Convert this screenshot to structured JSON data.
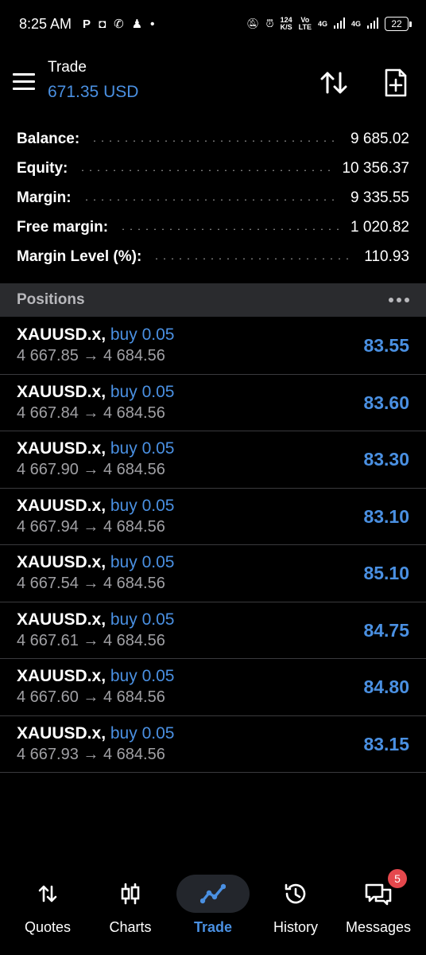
{
  "status_bar": {
    "time": "8:25 AM",
    "speed_value": "124",
    "speed_unit": "K/S",
    "volte_top": "Vo",
    "volte_bottom": "LTE",
    "net1": "4G",
    "net2": "4G",
    "battery": "22"
  },
  "header": {
    "title": "Trade",
    "subtitle": "671.35 USD"
  },
  "summary": [
    {
      "label": "Balance:",
      "value": "9 685.02"
    },
    {
      "label": "Equity:",
      "value": "10 356.37"
    },
    {
      "label": "Margin:",
      "value": "9 335.55"
    },
    {
      "label": "Free margin:",
      "value": "1 020.82"
    },
    {
      "label": "Margin Level (%):",
      "value": "110.93"
    }
  ],
  "positions_header": {
    "title": "Positions"
  },
  "positions": [
    {
      "symbol": "XAUUSD.x,",
      "side": "buy 0.05",
      "open": "4 667.85",
      "arrow": "→",
      "current": "4 684.56",
      "profit": "83.55"
    },
    {
      "symbol": "XAUUSD.x,",
      "side": "buy 0.05",
      "open": "4 667.84",
      "arrow": "→",
      "current": "4 684.56",
      "profit": "83.60"
    },
    {
      "symbol": "XAUUSD.x,",
      "side": "buy 0.05",
      "open": "4 667.90",
      "arrow": "→",
      "current": "4 684.56",
      "profit": "83.30"
    },
    {
      "symbol": "XAUUSD.x,",
      "side": "buy 0.05",
      "open": "4 667.94",
      "arrow": "→",
      "current": "4 684.56",
      "profit": "83.10"
    },
    {
      "symbol": "XAUUSD.x,",
      "side": "buy 0.05",
      "open": "4 667.54",
      "arrow": "→",
      "current": "4 684.56",
      "profit": "85.10"
    },
    {
      "symbol": "XAUUSD.x,",
      "side": "buy 0.05",
      "open": "4 667.61",
      "arrow": "→",
      "current": "4 684.56",
      "profit": "84.75"
    },
    {
      "symbol": "XAUUSD.x,",
      "side": "buy 0.05",
      "open": "4 667.60",
      "arrow": "→",
      "current": "4 684.56",
      "profit": "84.80"
    },
    {
      "symbol": "XAUUSD.x,",
      "side": "buy 0.05",
      "open": "4 667.93",
      "arrow": "→",
      "current": "4 684.56",
      "profit": "83.15"
    }
  ],
  "nav": [
    {
      "label": "Quotes",
      "icon": "quotes-icon"
    },
    {
      "label": "Charts",
      "icon": "charts-icon"
    },
    {
      "label": "Trade",
      "icon": "trade-icon",
      "active": true
    },
    {
      "label": "History",
      "icon": "history-icon"
    },
    {
      "label": "Messages",
      "icon": "messages-icon",
      "badge": "5"
    }
  ],
  "colors": {
    "accent": "#4a90e2",
    "background": "#000000",
    "section_bg": "#2a2b2e",
    "badge": "#e5484d"
  }
}
